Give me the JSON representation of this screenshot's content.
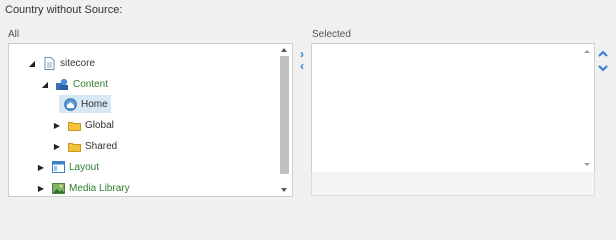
{
  "field": {
    "label": "Country without Source:"
  },
  "columns": {
    "all": "All",
    "selected": "Selected"
  },
  "tree": [
    {
      "label": "sitecore",
      "expanded": true,
      "icon": "page-icon",
      "color": "#333333"
    },
    {
      "label": "Content",
      "expanded": true,
      "icon": "content-icon",
      "color": "#2e7d2e"
    },
    {
      "label": "Home",
      "expanded": null,
      "icon": "home-globe-icon",
      "color": "#333333",
      "selected": true
    },
    {
      "label": "Global",
      "expanded": false,
      "icon": "folder-icon",
      "color": "#333333"
    },
    {
      "label": "Shared",
      "expanded": false,
      "icon": "folder-icon",
      "color": "#333333"
    },
    {
      "label": "Layout",
      "expanded": false,
      "icon": "layout-icon",
      "color": "#2e7d2e"
    },
    {
      "label": "Media Library",
      "expanded": false,
      "icon": "media-icon",
      "color": "#2e7d2e"
    }
  ],
  "buttons": {
    "add": "›",
    "remove": "‹"
  },
  "selected_items": [],
  "colors": {
    "accent": "#2f7ed8",
    "selected_bg": "#d6e8f5"
  }
}
